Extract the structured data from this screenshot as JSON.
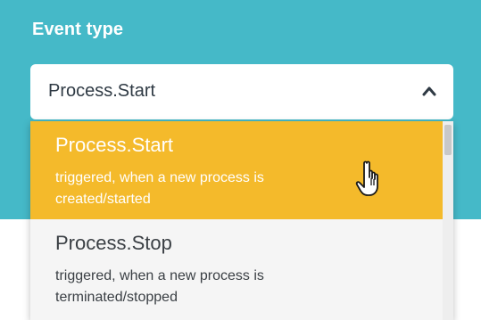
{
  "field": {
    "label": "Event type",
    "selected_value": "Process.Start",
    "expanded": true
  },
  "options": [
    {
      "title": "Process.Start",
      "description": "triggered, when a new process is created/started",
      "highlighted": true
    },
    {
      "title": "Process.Stop",
      "description": "triggered, when a new process is terminated/stopped",
      "highlighted": false
    }
  ],
  "colors": {
    "panel_bg": "#45b9c8",
    "highlight_bg": "#f4ba2b",
    "dropdown_bg": "#f5f5f5",
    "label_text": "#ffffff"
  },
  "icons": {
    "chevron": "chevron-up-icon",
    "cursor": "hand-pointer-icon"
  }
}
